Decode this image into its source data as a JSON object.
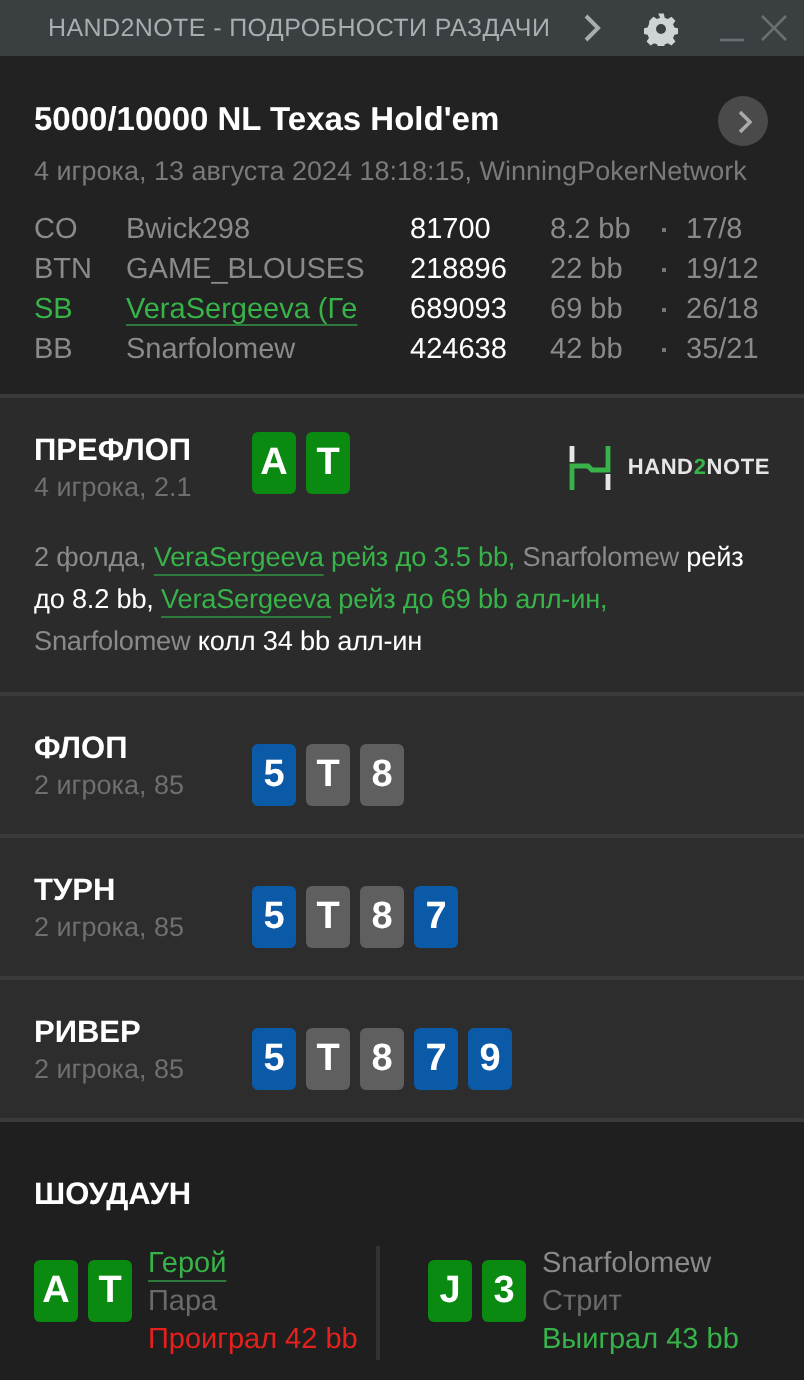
{
  "window": {
    "title": "HAND2NOTE - ПОДРОБНОСТИ РАЗДАЧИ"
  },
  "hand": {
    "title": "5000/10000 NL Texas Hold'em",
    "subtitle": "4 игрока, 13 августа 2024 18:18:15, WinningPokerNetwork"
  },
  "players": [
    {
      "position": "CO",
      "name": "Bwick298",
      "hero": false,
      "stack": "81700",
      "bb": "8.2 bb",
      "stats": "17/8"
    },
    {
      "position": "BTN",
      "name": "GAME_BLOUSES",
      "hero": false,
      "stack": "218896",
      "bb": "22 bb",
      "stats": "19/12"
    },
    {
      "position": "SB",
      "name": "VeraSergeeva (Ге",
      "hero": true,
      "stack": "689093",
      "bb": "69 bb",
      "stats": "26/18"
    },
    {
      "position": "BB",
      "name": "Snarfolomew",
      "hero": false,
      "stack": "424638",
      "bb": "42 bb",
      "stats": "35/21"
    }
  ],
  "logo": {
    "parts": [
      {
        "text": "HAND",
        "accent": false
      },
      {
        "text": "2",
        "accent": true
      },
      {
        "text": "NOTE",
        "accent": false
      }
    ]
  },
  "preflop": {
    "title": "ПРЕФЛОП",
    "subtitle": "4 игрока, 2.1",
    "cards": [
      {
        "rank": "A",
        "color": "#0b8a12"
      },
      {
        "rank": "T",
        "color": "#0b8a12"
      }
    ],
    "actions": [
      {
        "kind": "muted",
        "text": "2 фолда, "
      },
      {
        "kind": "hero-link",
        "text": "VeraSergeeva"
      },
      {
        "kind": "hero",
        "text": " рейз до 3.5 bb, "
      },
      {
        "kind": "muted",
        "text": "Snarfolomew"
      },
      {
        "kind": "plain",
        "text": " рейз до 8.2 bb, "
      },
      {
        "kind": "hero-link",
        "text": "VeraSergeeva"
      },
      {
        "kind": "hero",
        "text": " рейз до 69 bb алл-ин, "
      },
      {
        "kind": "muted",
        "text": "Snarfolomew"
      },
      {
        "kind": "plain",
        "text": " колл 34 bb алл-ин"
      }
    ]
  },
  "streets": [
    {
      "title": "ФЛОП",
      "subtitle": "2 игрока, 85",
      "cards": [
        {
          "rank": "5",
          "color": "#0b5aa8"
        },
        {
          "rank": "T",
          "color": "#5f5f5f"
        },
        {
          "rank": "8",
          "color": "#5f5f5f"
        }
      ]
    },
    {
      "title": "ТУРН",
      "subtitle": "2 игрока, 85",
      "cards": [
        {
          "rank": "5",
          "color": "#0b5aa8"
        },
        {
          "rank": "T",
          "color": "#5f5f5f"
        },
        {
          "rank": "8",
          "color": "#5f5f5f"
        },
        {
          "rank": "7",
          "color": "#0b5aa8"
        }
      ]
    },
    {
      "title": "РИВЕР",
      "subtitle": "2 игрока, 85",
      "cards": [
        {
          "rank": "5",
          "color": "#0b5aa8"
        },
        {
          "rank": "T",
          "color": "#5f5f5f"
        },
        {
          "rank": "8",
          "color": "#5f5f5f"
        },
        {
          "rank": "7",
          "color": "#0b5aa8"
        },
        {
          "rank": "9",
          "color": "#0b5aa8"
        }
      ]
    }
  ],
  "showdown": {
    "title": "ШОУДАУН",
    "hands": [
      {
        "name": "Герой",
        "hero": true,
        "combo": "Пара",
        "result": "Проиграл 42 bb",
        "won": false,
        "cards": [
          {
            "rank": "A",
            "color": "#0b8a12"
          },
          {
            "rank": "T",
            "color": "#0b8a12"
          }
        ]
      },
      {
        "name": "Snarfolomew",
        "hero": false,
        "combo": "Стрит",
        "result": "Выиграл 43 bb",
        "won": true,
        "cards": [
          {
            "rank": "J",
            "color": "#0b8a12"
          },
          {
            "rank": "3",
            "color": "#0b8a12"
          }
        ]
      }
    ]
  }
}
